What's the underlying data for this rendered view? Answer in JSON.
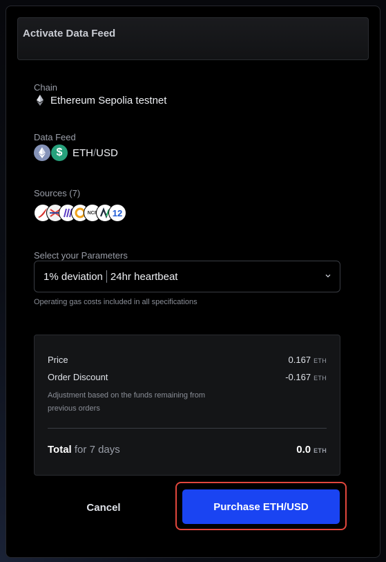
{
  "modal": {
    "title": "Activate Data Feed"
  },
  "chain": {
    "label": "Chain",
    "name": "Ethereum Sepolia testnet",
    "icon": "ethereum-icon"
  },
  "data_feed": {
    "label": "Data Feed",
    "base": "ETH",
    "separator": "/",
    "quote": "USD",
    "icons": [
      "eth-coin-icon",
      "usd-coin-icon"
    ],
    "usd_symbol": "$",
    "colors": {
      "eth": "#8593b8",
      "usd": "#27a17c"
    }
  },
  "sources": {
    "label": "Sources (7)",
    "items": [
      {
        "name": "source-1-icon",
        "bg": "#ffffff"
      },
      {
        "name": "source-2-icon",
        "bg": "#ffffff"
      },
      {
        "name": "source-3-icon",
        "bg": "#ffffff"
      },
      {
        "name": "source-4-icon",
        "bg": "#ffffff"
      },
      {
        "name": "source-5-icon",
        "bg": "#ffffff",
        "text": "NCP"
      },
      {
        "name": "source-6-icon",
        "bg": "#ffffff"
      },
      {
        "name": "source-7-icon",
        "bg": "#ffffff",
        "text": "12"
      }
    ]
  },
  "parameters": {
    "label": "Select your Parameters",
    "deviation": "1% deviation",
    "heartbeat": "24hr heartbeat",
    "hint": "Operating gas costs included in all specifications"
  },
  "summary": {
    "price_label": "Price",
    "price_value": "0.167",
    "discount_label": "Order Discount",
    "discount_value": "-0.167",
    "note": "Adjustment based on the funds remaining from previous orders",
    "total_label": "Total",
    "total_period": "for 7 days",
    "total_value": "0.0",
    "unit": "ETH"
  },
  "actions": {
    "cancel": "Cancel",
    "purchase": "Purchase ETH/USD"
  },
  "colors": {
    "primary_button": "#1a44f2",
    "highlight_border": "#e2473d",
    "background": "#000000"
  }
}
